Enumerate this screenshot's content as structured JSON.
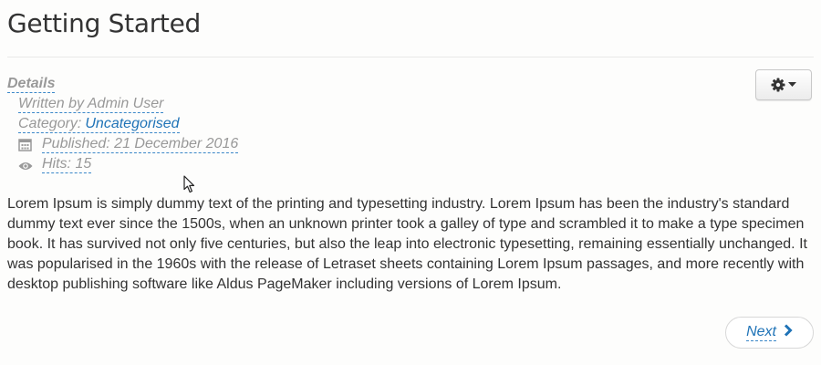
{
  "article": {
    "title": "Getting Started",
    "body": "Lorem Ipsum is simply dummy text of the printing and typesetting industry. Lorem Ipsum has been the industry's standard dummy text ever since the 1500s, when an unknown printer took a galley of type and scrambled it to make a type specimen book. It has survived not only five centuries, but also the leap into electronic typesetting, remaining essentially unchanged. It was popularised in the 1960s with the release of Letraset sheets containing Lorem Ipsum passages, and more recently with desktop publishing software like Aldus PageMaker including versions of Lorem Ipsum."
  },
  "info": {
    "details_label": "Details",
    "written_by": "Written by Admin User",
    "category_prefix": "Category:",
    "category": "Uncategorised",
    "published": "Published: 21 December 2016",
    "hits": "Hits: 15",
    "published_icon": "calendar-icon",
    "hits_icon": "eye-icon"
  },
  "toolbar": {
    "tools_icon": "gear-icon",
    "dropdown_icon": "caret-down-icon"
  },
  "pagination": {
    "next_label": "Next",
    "next_icon": "chevron-right-icon"
  },
  "colors": {
    "link": "#1f73b7",
    "muted": "#999999",
    "text": "#333333"
  }
}
